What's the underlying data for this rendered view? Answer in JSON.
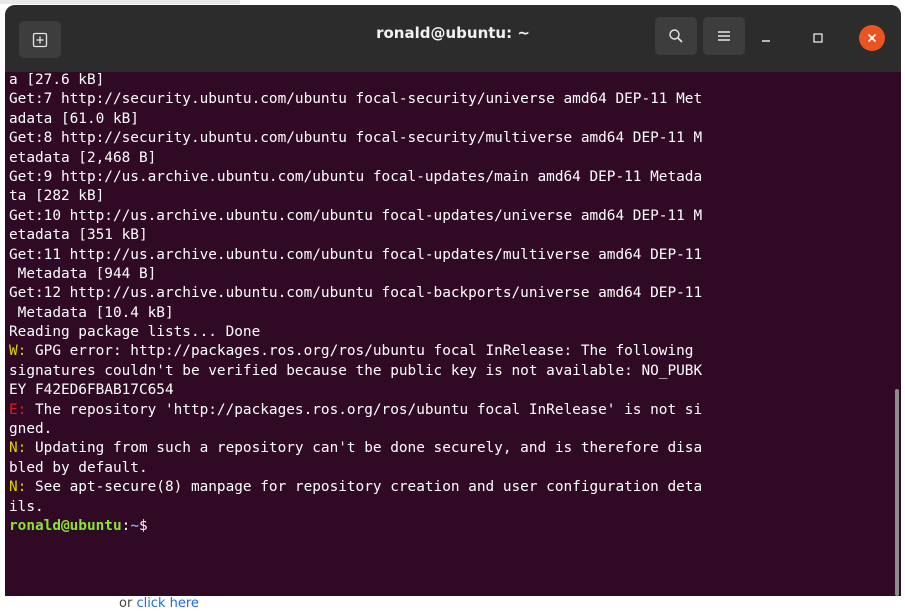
{
  "window": {
    "title": "ronald@ubuntu: ~",
    "icons": {
      "new_tab": "new-tab-icon",
      "search": "search-icon",
      "menu": "hamburger-menu-icon",
      "minimize": "minimize-icon",
      "maximize": "maximize-icon",
      "close": "close-icon"
    }
  },
  "terminal": {
    "lines": [
      "a [27.6 kB]",
      "Get:7 http://security.ubuntu.com/ubuntu focal-security/universe amd64 DEP-11 Met",
      "adata [61.0 kB]",
      "Get:8 http://security.ubuntu.com/ubuntu focal-security/multiverse amd64 DEP-11 M",
      "etadata [2,468 B]",
      "Get:9 http://us.archive.ubuntu.com/ubuntu focal-updates/main amd64 DEP-11 Metada",
      "ta [282 kB]",
      "Get:10 http://us.archive.ubuntu.com/ubuntu focal-updates/universe amd64 DEP-11 M",
      "etadata [351 kB]",
      "Get:11 http://us.archive.ubuntu.com/ubuntu focal-updates/multiverse amd64 DEP-11",
      " Metadata [944 B]",
      "Get:12 http://us.archive.ubuntu.com/ubuntu focal-backports/universe amd64 DEP-11",
      " Metadata [10.4 kB]",
      "Reading package lists... Done"
    ],
    "w_prefix": "W:",
    "e_prefix": "E:",
    "n_prefix": "N:",
    "warning_lines": [
      " GPG error: http://packages.ros.org/ros/ubuntu focal InRelease: The following",
      "signatures couldn't be verified because the public key is not available: NO_PUBK",
      "EY F42ED6FBAB17C654"
    ],
    "error_lines": [
      " The repository 'http://packages.ros.org/ros/ubuntu focal InRelease' is not si",
      "gned."
    ],
    "note1_lines": [
      " Updating from such a repository can't be done securely, and is therefore disa",
      "bled by default."
    ],
    "note2_lines": [
      " See apt-secure(8) manpage for repository creation and user configuration deta",
      "ils."
    ],
    "prompt": {
      "user": "ronald@ubuntu",
      "colon": ":",
      "path": "~",
      "symbol": "$"
    }
  },
  "below": {
    "prefix": "or ",
    "link": "click here"
  },
  "colors": {
    "terminal_bg": "#300a24",
    "titlebar_bg": "#2c2c2c",
    "close_button": "#e95420",
    "warning": "#d6d600",
    "error": "#e01b1b",
    "prompt_user": "#8ae234",
    "prompt_path": "#7aa6da"
  }
}
